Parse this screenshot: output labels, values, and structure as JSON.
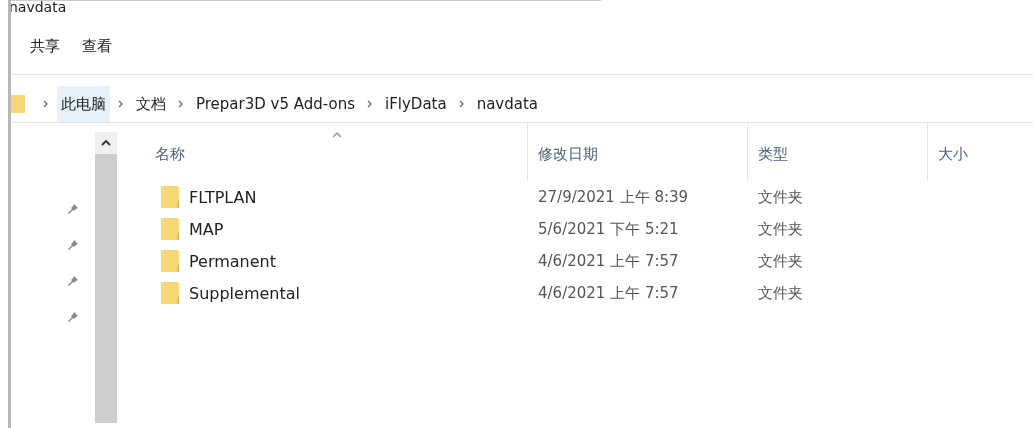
{
  "window": {
    "title": "navdata"
  },
  "ribbon_tabs": [
    "共享",
    "查看"
  ],
  "breadcrumb": [
    {
      "label": "此电脑",
      "selected": true
    },
    {
      "label": "文档",
      "selected": false
    },
    {
      "label": "Prepar3D v5 Add-ons",
      "selected": false
    },
    {
      "label": "iFlyData",
      "selected": false
    },
    {
      "label": "navdata",
      "selected": false
    }
  ],
  "table": {
    "columns": [
      "名称",
      "修改日期",
      "类型",
      "大小"
    ],
    "rows": [
      {
        "name": "FLTPLAN",
        "modified": "27/9/2021 上午 8:39",
        "type": "文件夹"
      },
      {
        "name": "MAP",
        "modified": "5/6/2021 下午 5:21",
        "type": "文件夹"
      },
      {
        "name": "Permanent",
        "modified": "4/6/2021 上午 7:57",
        "type": "文件夹"
      },
      {
        "name": "Supplemental",
        "modified": "4/6/2021 上午 7:57",
        "type": "文件夹"
      }
    ]
  }
}
